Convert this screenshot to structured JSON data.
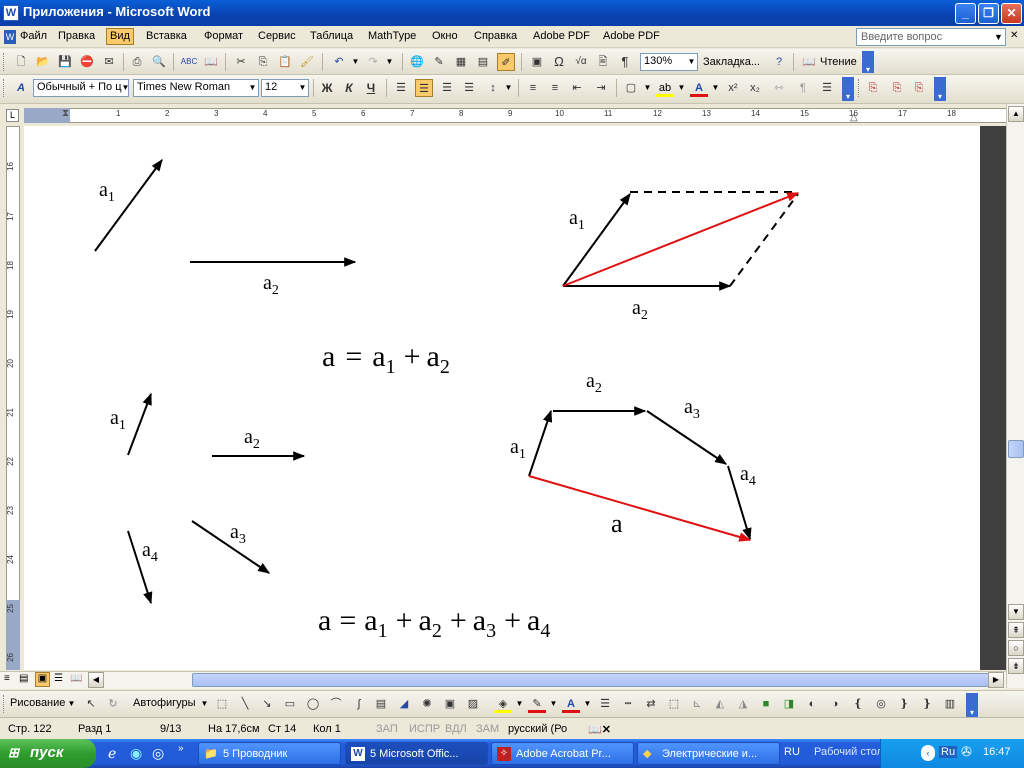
{
  "window": {
    "title": "Приложения - Microsoft Word",
    "icon": "word-app-icon"
  },
  "menu": {
    "items": [
      "Файл",
      "Правка",
      "Вид",
      "Вставка",
      "Формат",
      "Сервис",
      "Таблица",
      "MathType",
      "Окно",
      "Справка",
      "Adobe PDF",
      "Adobe PDF"
    ],
    "active_index": 2,
    "ask_placeholder": "Введите вопрос"
  },
  "standard_toolbar": {
    "zoom": "130%",
    "bookmark_label": "Закладка...",
    "reading_label": "Чтение"
  },
  "format_toolbar": {
    "style": "Обычный + По ц",
    "font": "Times New Roman",
    "size": "12",
    "bold": "Ж",
    "italic": "К",
    "underline": "Ч"
  },
  "ruler": {
    "h_numbers": [
      "1",
      "2",
      "3",
      "4",
      "5",
      "6",
      "7",
      "8",
      "9",
      "10",
      "11",
      "12",
      "13",
      "14",
      "15",
      "16",
      "17",
      "18"
    ],
    "v_numbers": [
      "16",
      "17",
      "18",
      "19",
      "20",
      "21",
      "22",
      "23",
      "24",
      "25",
      "26"
    ]
  },
  "document": {
    "labels": {
      "a": "a",
      "a1": "a",
      "a2": "a",
      "a3": "a",
      "a4": "a",
      "sub1": "1",
      "sub2": "2",
      "sub3": "3",
      "sub4": "4"
    },
    "equation1": {
      "lhs": "a",
      "eq": "=",
      "t1": "a",
      "s1": "1",
      "plus": "+",
      "t2": "a",
      "s2": "2"
    },
    "equation2": {
      "lhs": "a",
      "eq": "=",
      "t1": "a",
      "s1": "1",
      "p1": "+",
      "t2": "a",
      "s2": "2",
      "p2": "+",
      "t3": "a",
      "s3": "3",
      "p3": "+",
      "t4": "a",
      "s4": "4"
    },
    "colors": {
      "vector": "#000000",
      "result": "#e01010"
    }
  },
  "drawing_toolbar": {
    "drawing_label": "Рисование",
    "autoshapes_label": "Автофигуры"
  },
  "status": {
    "page": "Стр. 122",
    "section": "Разд 1",
    "pages": "9/13",
    "at": "На 17,6см",
    "line": "Ст 14",
    "col": "Кол 1",
    "rec": "ЗАП",
    "trk": "ИСПР",
    "ext": "ВДЛ",
    "ovr": "ЗАМ",
    "lang": "русский (Ро"
  },
  "taskbar": {
    "start_label": "пуск",
    "tasks": [
      "5 Проводник",
      "5 Microsoft Offic...",
      "Adobe Acrobat Pr...",
      "Электрические и..."
    ],
    "active_task_index": 1,
    "lang": "RU",
    "desktop_label": "Рабочий стол",
    "tray_lang": "Ru",
    "clock": "16:47"
  }
}
